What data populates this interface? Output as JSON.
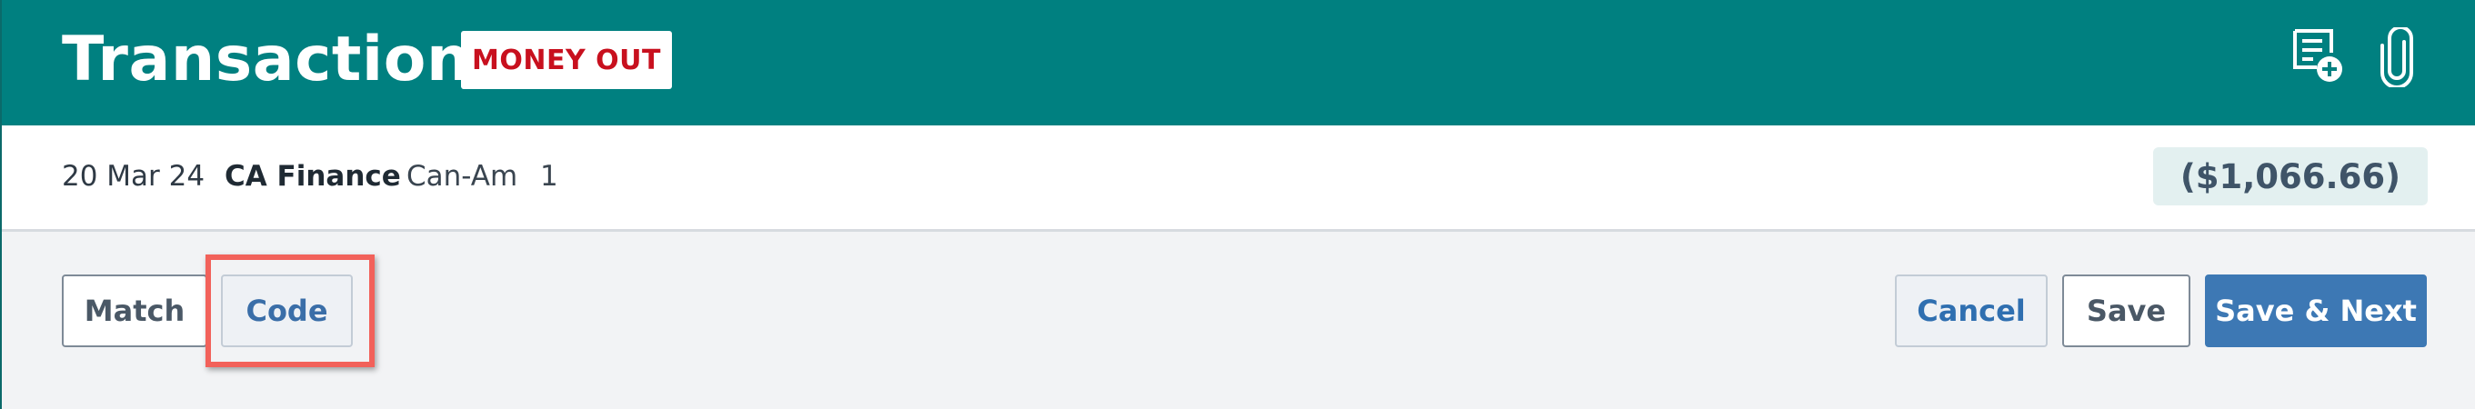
{
  "header": {
    "title": "Transaction",
    "badge": "MONEY OUT",
    "icons": [
      "add-note-icon",
      "paperclip-icon"
    ]
  },
  "summary": {
    "date": "20 Mar 24",
    "payee": "CA Finance",
    "reference": "Can-Am",
    "number": "1",
    "amount": "($1,066.66)"
  },
  "actions": {
    "match_label": "Match",
    "code_label": "Code",
    "cancel_label": "Cancel",
    "save_label": "Save",
    "save_next_label": "Save & Next"
  },
  "colors": {
    "header_bg": "#008080",
    "badge_text": "#c8101e",
    "primary_button": "#3d78b4",
    "highlight": "#f2615a",
    "amount_bg": "#e3f0f0"
  }
}
